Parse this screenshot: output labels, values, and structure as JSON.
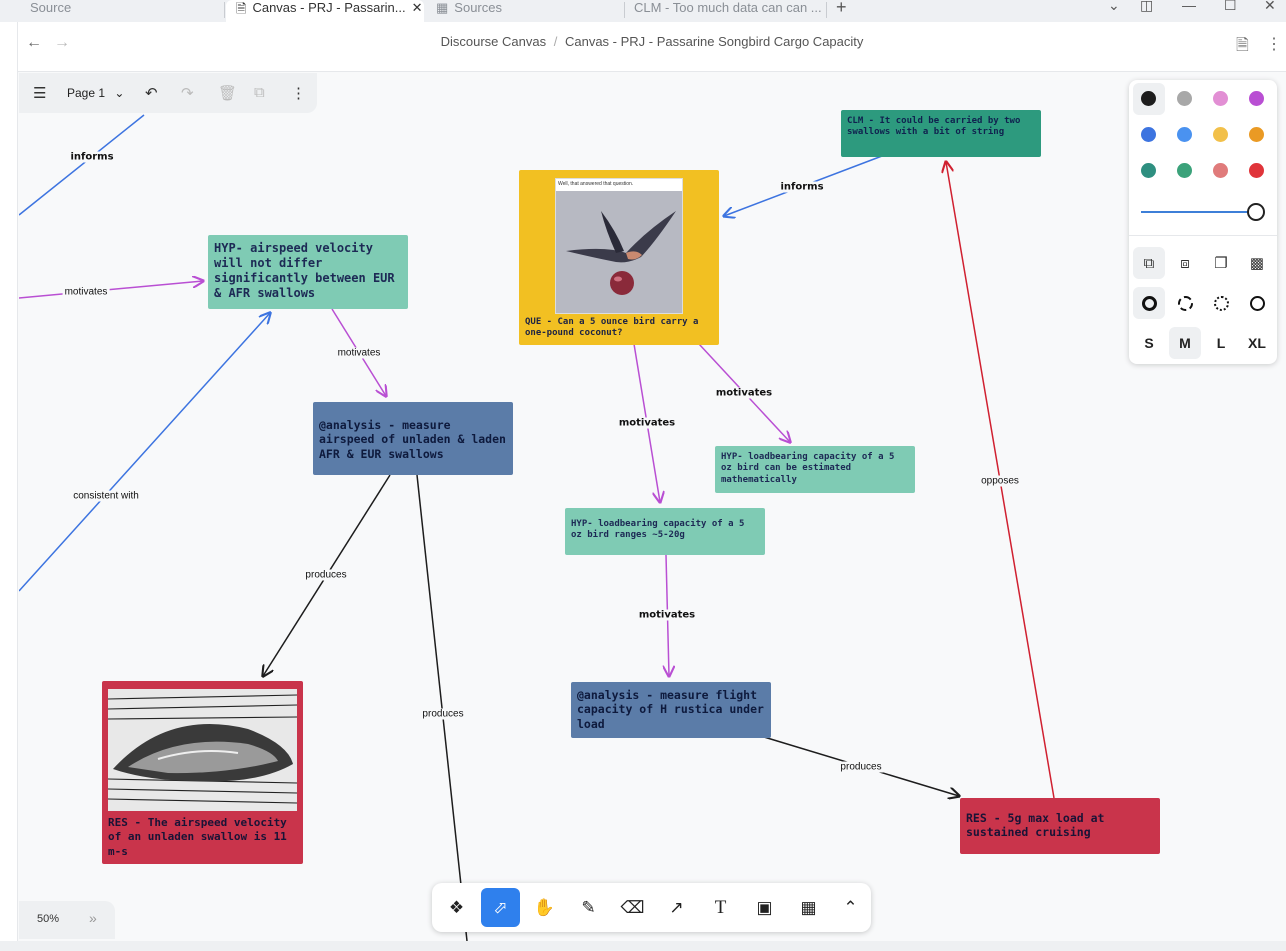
{
  "tabs": [
    {
      "label": "Source"
    },
    {
      "label": "Canvas - PRJ - Passarin..."
    },
    {
      "label": "Sources"
    },
    {
      "label": "CLM - Too much data can can ..."
    }
  ],
  "breadcrumb": {
    "parent": "Discourse Canvas",
    "sep": "/",
    "current": "Canvas - PRJ - Passarine Songbird Cargo Capacity"
  },
  "canvas_toolbar": {
    "page_label": "Page 1"
  },
  "nodes": {
    "clm": "CLM - It could be carried by two swallows with a bit of string",
    "que": "QUE - Can a 5 ounce bird carry a one-pound coconut?",
    "que_image_caption": "Well, that answered that question.",
    "hyp_airspeed": "HYP- airspeed velocity will not differ significantly between EUR & AFR swallows",
    "analysis_airspeed": "@analysis - measure airspeed of unladen & laden AFR & EUR swallows",
    "hyp_load_math": "HYP- loadbearing capacity of a 5 oz bird can be estimated mathematically",
    "hyp_load_range": "HYP- loadbearing capacity of a 5 oz bird ranges ~5-20g",
    "analysis_flight": "@analysis - measure flight capacity of H rustica under load",
    "res_airspeed": "RES - The airspeed velocity of an unladen swallow is 11 m-s",
    "res_load": "RES - 5g max load at sustained cruising"
  },
  "edge_labels": {
    "informs_left": "informs",
    "motivates_left": "motivates",
    "consistent_with": "consistent with",
    "motivates_hyp_analysis": "motivates",
    "produces_res": "produces",
    "produces_down": "produces",
    "informs_clm": "informs",
    "motivates_que_load": "motivates",
    "motivates_que_range": "motivates",
    "motivates_range_flight": "motivates",
    "produces_flight": "produces",
    "opposes": "opposes"
  },
  "style_panel": {
    "colors": [
      "#1d1d1d",
      "#a8a8a8",
      "#e28fd4",
      "#b94fd3",
      "#3d74e0",
      "#4a92f0",
      "#f2c04a",
      "#ea9a24",
      "#2e8f80",
      "#3ba27a",
      "#e07b7b",
      "#e0343a"
    ],
    "sizes": [
      "S",
      "M",
      "L",
      "XL"
    ],
    "selected_size": "M"
  },
  "zoom": {
    "value": "50%"
  }
}
